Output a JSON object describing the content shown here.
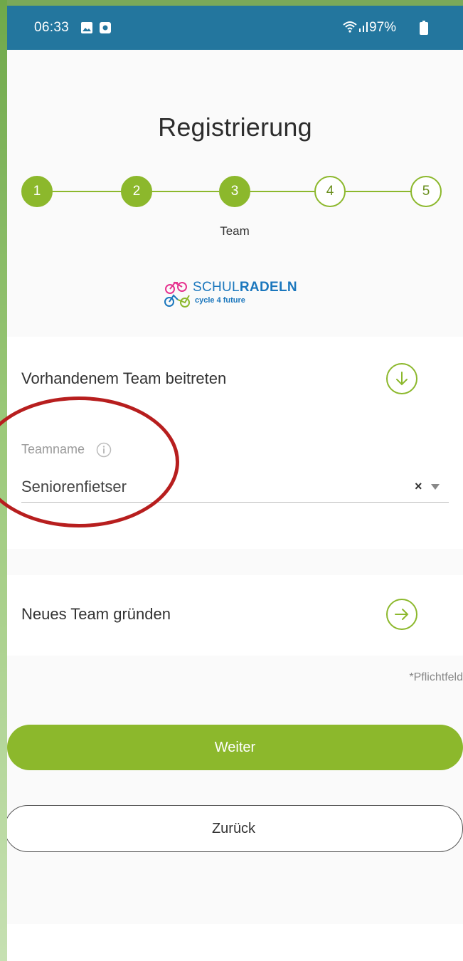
{
  "status_bar": {
    "time": "06:33",
    "battery_percent": "97%",
    "icons": [
      "gallery-icon",
      "screen-record-icon",
      "wifi-icon",
      "signal-icon",
      "battery-icon"
    ]
  },
  "page": {
    "title": "Registrierung"
  },
  "stepper": {
    "steps": [
      "1",
      "2",
      "3",
      "4",
      "5"
    ],
    "completed_up_to": 3,
    "current_caption": "Team"
  },
  "logo": {
    "main_light": "SCHUL",
    "main_bold": "RADELN",
    "sub": "cycle 4 future"
  },
  "join_team": {
    "title": "Vorhandenem Team beitreten",
    "action_icon": "arrow-down-circle-icon",
    "field_label": "Teamname",
    "field_value": "Seniorenfietser"
  },
  "new_team": {
    "title": "Neues Team gründen",
    "action_icon": "arrow-right-circle-icon"
  },
  "form": {
    "required_note": "*Pflichtfeld",
    "next_label": "Weiter",
    "back_label": "Zurück"
  },
  "colors": {
    "accent": "#8cb82c",
    "status_bar": "#23769e",
    "annotation": "#b71e1e"
  }
}
